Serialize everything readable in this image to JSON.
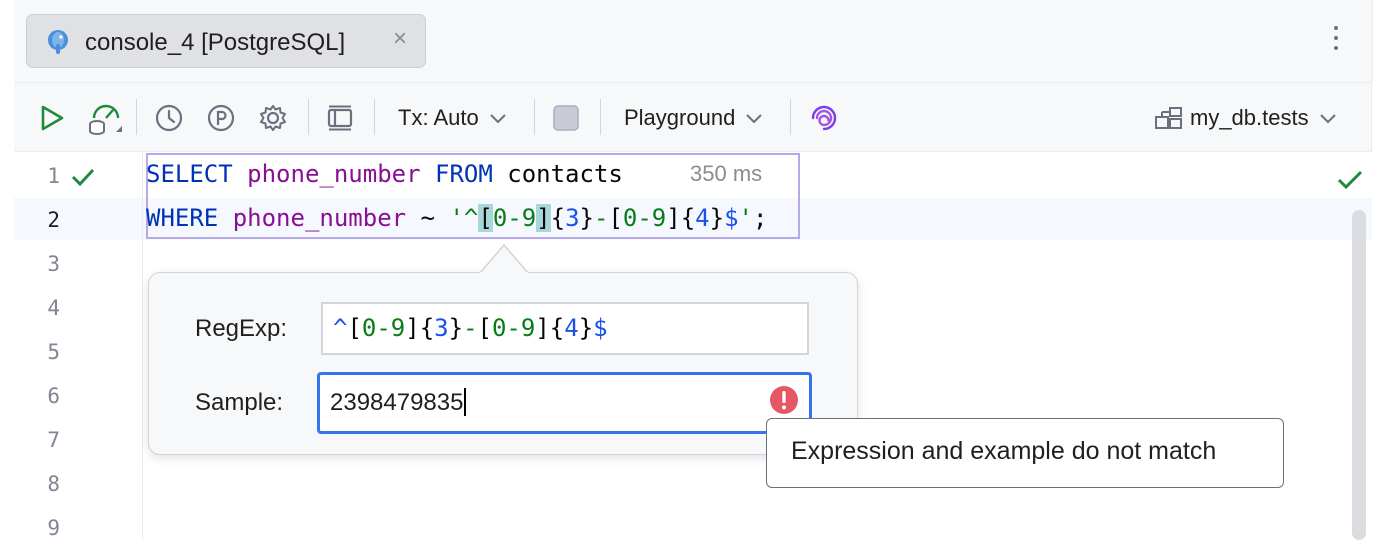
{
  "tab": {
    "label": "console_4 [PostgreSQL]",
    "close": "×"
  },
  "toolbar": {
    "tx_mode": "Tx: Auto",
    "mode": "Playground",
    "datasource": "my_db.tests",
    "icons": [
      "run-icon",
      "explain-plan-icon",
      "history-icon",
      "parameters-icon",
      "settings-icon",
      "layout-icon",
      "stop-icon",
      "ai-assistant-icon",
      "datasource-icon"
    ]
  },
  "editor": {
    "line_numbers": [
      "1",
      "2",
      "3",
      "4",
      "5",
      "6",
      "7",
      "8",
      "9"
    ],
    "line1": {
      "select": "SELECT",
      "column": "phone_number",
      "from": "FROM",
      "table": "contacts"
    },
    "line2": {
      "where": "WHERE",
      "column": "phone_number",
      "op": "~",
      "q1": "'",
      "caret": "^",
      "lb1": "[",
      "r1": "0-9",
      "rb1": "]",
      "lc1": "{",
      "n1": "3",
      "rc1": "}",
      "dash": "-",
      "lb2": "[",
      "r2": "0-9",
      "rb2": "]",
      "lc2": "{",
      "n2": "4",
      "rc2": "}",
      "dollar": "$",
      "q2": "'",
      "semi": ";"
    },
    "timing": "350 ms"
  },
  "regex_popup": {
    "regexp_label": "RegExp:",
    "sample_label": "Sample:",
    "regexp": {
      "caret": "^",
      "lb1": "[",
      "r1": "0-9",
      "rb1": "]",
      "lc1": "{",
      "n1": "3",
      "rc1": "}",
      "dash": "-",
      "lb2": "[",
      "r2": "0-9",
      "rb2": "]",
      "lc2": "{",
      "n2": "4",
      "rc2": "}",
      "dollar": "$"
    },
    "sample_value": "2398479835"
  },
  "tooltip": {
    "text": "Expression and example do not match"
  },
  "colors": {
    "keyword": "#0033b3",
    "column": "#871094",
    "string": "#067d17",
    "number": "#1750eb",
    "focus": "#3574f0",
    "error": "#e55765",
    "success": "#208a3c"
  }
}
